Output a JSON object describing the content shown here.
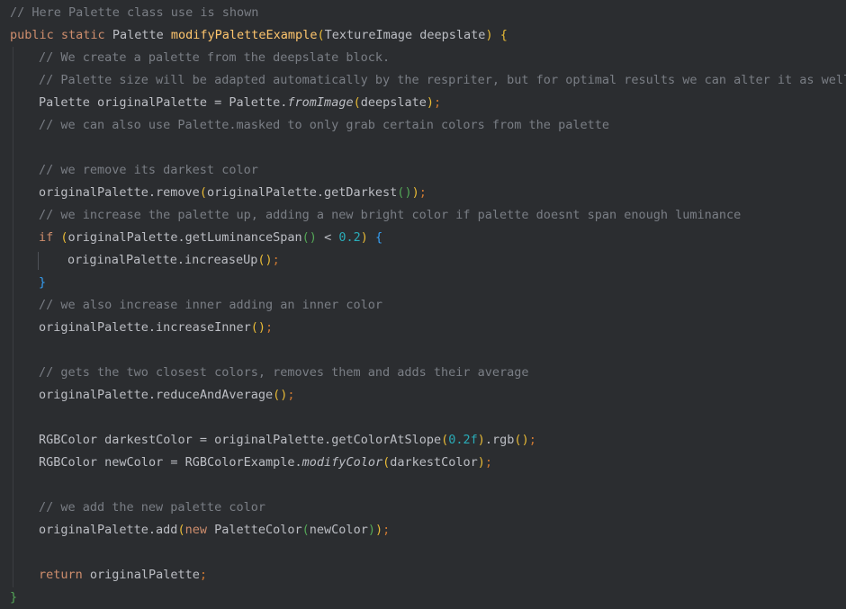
{
  "code": {
    "l1": {
      "comment": "// Here Palette class use is shown"
    },
    "l2": {
      "kw_public": "public",
      "kw_static": "static",
      "return_type": "Palette",
      "method_name": "modifyPaletteExample",
      "paren_open": "(",
      "param_type": "TextureImage",
      "param_name": "deepslate",
      "paren_close": ")",
      "brace_open": "{"
    },
    "l3": {
      "comment": "// We create a palette from the deepslate block."
    },
    "l4": {
      "comment": "// Palette size will be adapted automatically by the respriter, but for optimal results we can alter it as well"
    },
    "l5": {
      "type": "Palette",
      "var": "originalPalette",
      "op": "=",
      "cls": "Palette.",
      "method": "fromImage",
      "po": "(",
      "arg": "deepslate",
      "pc": ")",
      "semi": ";"
    },
    "l6": {
      "comment": "// we can also use Palette.masked to only grab certain colors from the palette"
    },
    "l8": {
      "comment": "// we remove its darkest color"
    },
    "l9": {
      "obj": "originalPalette.",
      "method": "remove",
      "po": "(",
      "inner_obj": "originalPalette.",
      "inner_method": "getDarkest",
      "ipo": "(",
      "ipc": ")",
      "pc": ")",
      "semi": ";"
    },
    "l10": {
      "comment": "// we increase the palette up, adding a new bright color if palette doesnt span enough luminance"
    },
    "l11": {
      "kw_if": "if",
      "po": "(",
      "expr": "originalPalette.getLuminanceSpan",
      "ipo": "(",
      "ipc": ")",
      "op": "<",
      "num": "0.2",
      "pc": ")",
      "brace": "{"
    },
    "l12": {
      "obj": "originalPalette.",
      "method": "increaseUp",
      "po": "(",
      "pc": ")",
      "semi": ";"
    },
    "l13": {
      "brace": "}"
    },
    "l14": {
      "comment": "// we also increase inner adding an inner color"
    },
    "l15": {
      "obj": "originalPalette.",
      "method": "increaseInner",
      "po": "(",
      "pc": ")",
      "semi": ";"
    },
    "l17": {
      "comment": "// gets the two closest colors, removes them and adds their average"
    },
    "l18": {
      "obj": "originalPalette.",
      "method": "reduceAndAverage",
      "po": "(",
      "pc": ")",
      "semi": ";"
    },
    "l20": {
      "type": "RGBColor",
      "var": "darkestColor",
      "op": "=",
      "obj": "originalPalette.",
      "method": "getColorAtSlope",
      "po": "(",
      "num": "0.2f",
      "pc": ")",
      "rest": ".rgb",
      "po2": "(",
      "pc2": ")",
      "semi": ";"
    },
    "l21": {
      "type": "RGBColor",
      "var": "newColor",
      "op": "=",
      "cls": "RGBColorExample.",
      "method": "modifyColor",
      "po": "(",
      "arg": "darkestColor",
      "pc": ")",
      "semi": ";"
    },
    "l23": {
      "comment": "// we add the new palette color"
    },
    "l24": {
      "obj": "originalPalette.",
      "method": "add",
      "po": "(",
      "kw_new": "new",
      "cls": "PaletteColor",
      "ipo": "(",
      "arg": "newColor",
      "ipc": ")",
      "pc": ")",
      "semi": ";"
    },
    "l26": {
      "kw_return": "return",
      "var": "originalPalette",
      "semi": ";"
    },
    "l27": {
      "brace": "}"
    }
  },
  "colors": {
    "background": "#2b2d30",
    "comment": "#7a7e85",
    "keyword": "#cf8e6d",
    "method_decl": "#56a8f5",
    "number": "#2aacb8",
    "text": "#bcbec4"
  }
}
